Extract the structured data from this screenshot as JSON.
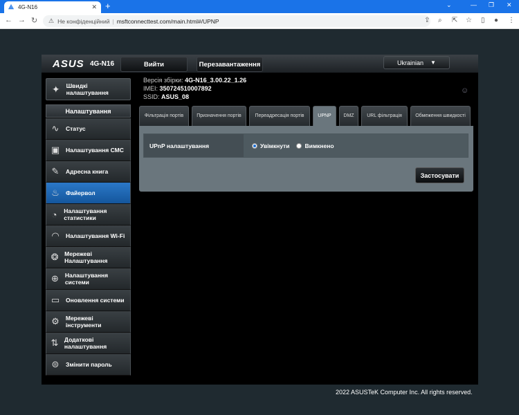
{
  "browser": {
    "tab_title": "4G-N16",
    "url_warning": "Не конфіденційний",
    "url": "msftconnecttest.com/main.html#/UPNP"
  },
  "header": {
    "logo": "ASUS",
    "model": "4G-N16",
    "logout_label": "Вийти",
    "reboot_label": "Перезавантаження",
    "language": "Ukrainian"
  },
  "info": {
    "firmware_label": "Версія збірки:",
    "firmware_value": "4G-N16_3.00.22_1.26",
    "imei_label": "IMEI:",
    "imei_value": "350724510007892",
    "ssid_label": "SSID:",
    "ssid_value": "ASUS_08"
  },
  "sidebar": {
    "quick_setup": "Швидкі налаштування",
    "section_title": "Налаштування",
    "items": [
      {
        "label": "Статус",
        "icon": "status-icon"
      },
      {
        "label": "Налаштування СМС",
        "icon": "sms-icon"
      },
      {
        "label": "Адресна книга",
        "icon": "address-book-icon"
      },
      {
        "label": "Файервол",
        "icon": "firewall-icon"
      },
      {
        "label": "Налаштування статистики",
        "icon": "statistics-icon"
      },
      {
        "label": "Налаштування Wi-Fi",
        "icon": "wifi-icon"
      },
      {
        "label": "Мережеві Налаштування",
        "icon": "network-icon"
      },
      {
        "label": "Налаштування системи",
        "icon": "globe-icon"
      },
      {
        "label": "Оновлення системи",
        "icon": "update-icon"
      },
      {
        "label": "Мережеві інструменти",
        "icon": "tools-icon"
      },
      {
        "label": "Додаткові налаштування",
        "icon": "advanced-icon"
      },
      {
        "label": "Змінити пароль",
        "icon": "lock-icon"
      }
    ]
  },
  "tabs": [
    {
      "label": "Фільтрація портів"
    },
    {
      "label": "Призначення портів"
    },
    {
      "label": "Переадресація портів"
    },
    {
      "label": "UPNP"
    },
    {
      "label": "DMZ"
    },
    {
      "label": "URL фільтрація"
    },
    {
      "label": "Обмеження швидкості"
    }
  ],
  "upnp": {
    "label": "UPnP налаштування",
    "option_on": "Увімкнути",
    "option_off": "Вимкнено",
    "apply": "Застосувати"
  },
  "footer": "2022 ASUSTeK Computer Inc. All rights reserved."
}
